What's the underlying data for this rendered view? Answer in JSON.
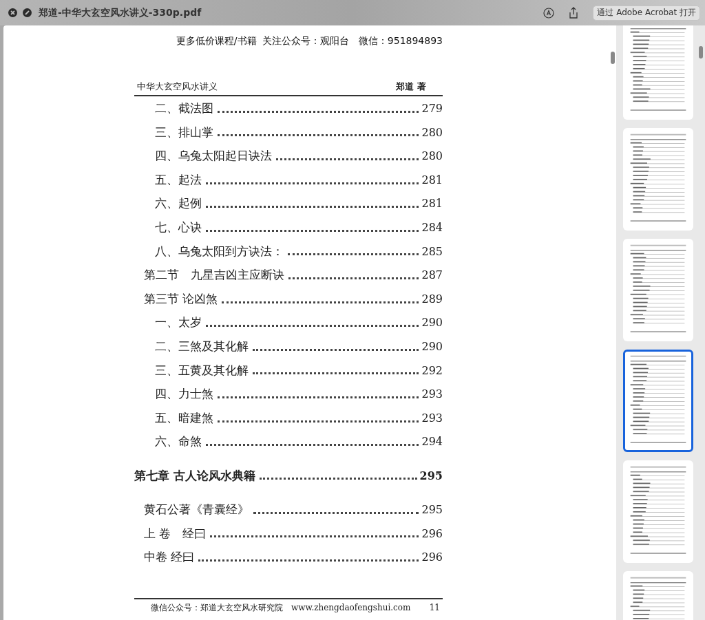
{
  "window": {
    "title": "郑道-中华大玄空风水讲义-330p.pdf",
    "open_button": "通过 Adobe Acrobat 打开"
  },
  "document": {
    "banner": "更多低价课程/书籍  关注公众号：观阳台   微信：951894893",
    "running_title": "中华大玄空风水讲义",
    "author": "郑道 著",
    "toc": [
      {
        "kind": "item",
        "title": "二、截法图",
        "page": "279"
      },
      {
        "kind": "item",
        "title": "三、排山掌",
        "page": "280"
      },
      {
        "kind": "item",
        "title": "四、乌兔太阳起日诀法",
        "page": "280"
      },
      {
        "kind": "item",
        "title": "五、起法",
        "page": "281"
      },
      {
        "kind": "item",
        "title": "六、起例",
        "page": "281"
      },
      {
        "kind": "item",
        "title": "七、心诀",
        "page": "284"
      },
      {
        "kind": "item",
        "title": "八、乌兔太阳到方诀法：",
        "page": "285"
      },
      {
        "kind": "section",
        "title": "第二节　九星吉凶主应断诀",
        "page": "287"
      },
      {
        "kind": "section",
        "title": "第三节 论凶煞",
        "page": "289"
      },
      {
        "kind": "item",
        "title": "一、太岁",
        "page": "290"
      },
      {
        "kind": "item",
        "title": "二、三煞及其化解",
        "page": "290"
      },
      {
        "kind": "item",
        "title": "三、五黄及其化解",
        "page": "292"
      },
      {
        "kind": "item",
        "title": "四、力士煞",
        "page": "293"
      },
      {
        "kind": "item",
        "title": "五、暗建煞",
        "page": "293"
      },
      {
        "kind": "item",
        "title": "六、命煞",
        "page": "294"
      },
      {
        "kind": "chapter",
        "title": "第七章 古人论风水典籍",
        "page": "295"
      },
      {
        "kind": "section",
        "title": "黄石公著《青囊经》",
        "page": "295"
      },
      {
        "kind": "section",
        "title": "上 卷　经曰",
        "page": "296"
      },
      {
        "kind": "section",
        "title": "中卷 经曰",
        "page": "296"
      }
    ],
    "footer": {
      "text": "微信公众号：郑道大玄空风水研究院",
      "url": "www.zhengdaofengshui.com",
      "page_number": "11"
    }
  },
  "thumbnails": [
    {
      "selected": false
    },
    {
      "selected": false
    },
    {
      "selected": false
    },
    {
      "selected": true
    },
    {
      "selected": false
    },
    {
      "selected": false
    }
  ]
}
